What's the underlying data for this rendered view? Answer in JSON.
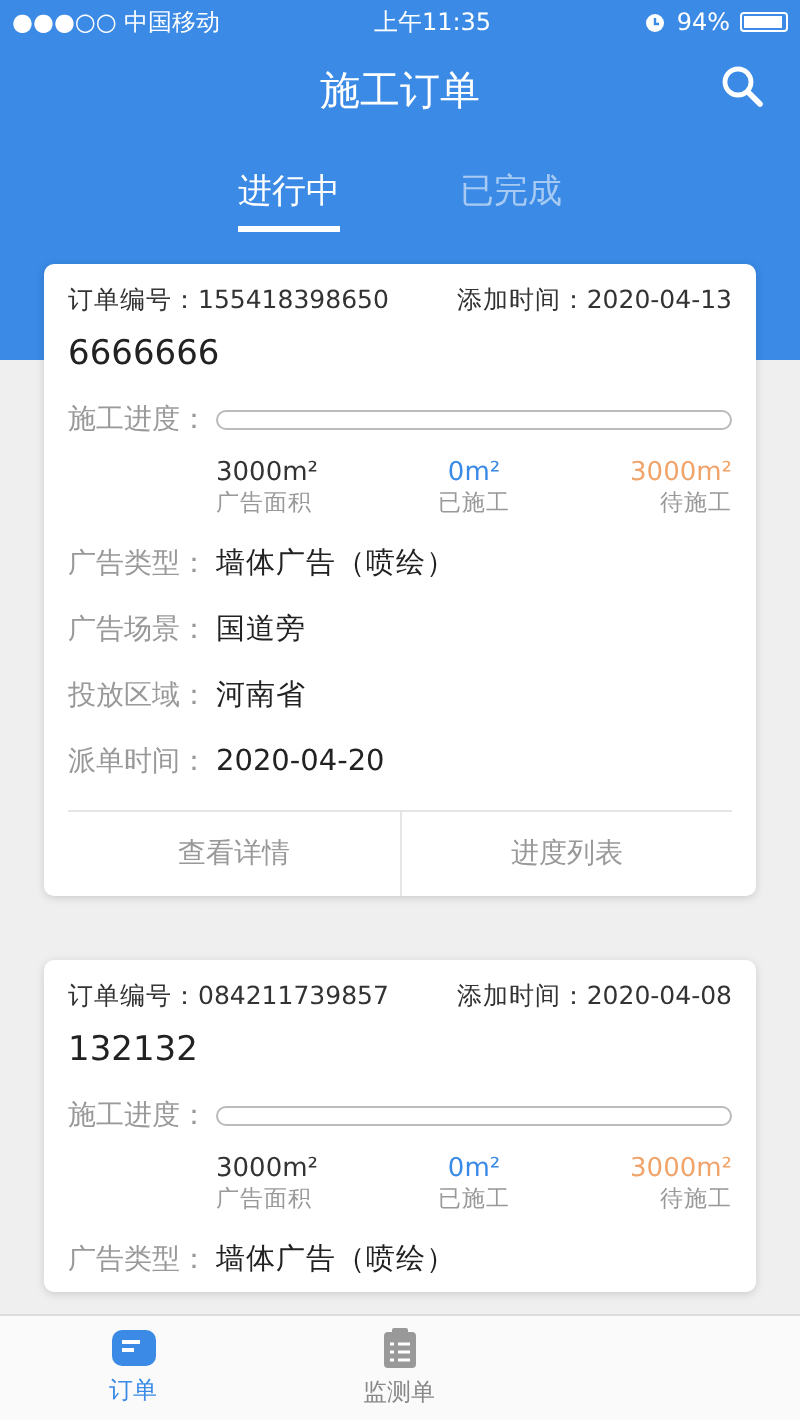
{
  "status_bar": {
    "carrier": "●●●○○ 中国移动",
    "time": "上午11:35",
    "battery": "94%"
  },
  "header": {
    "title": "施工订单"
  },
  "tabs": [
    {
      "label": "进行中",
      "selected": true
    },
    {
      "label": "已完成",
      "selected": false
    }
  ],
  "orders": [
    {
      "order_no_label": "订单编号：",
      "order_no": "155418398650",
      "added_label": "添加时间：",
      "added": "2020-04-13",
      "name": "6666666",
      "progress_label": "施工进度：",
      "level": 0,
      "stats": [
        {
          "value": "3000m²",
          "label": "广告面积",
          "kind": "total"
        },
        {
          "value": "0m²",
          "label": "已施工",
          "kind": "done"
        },
        {
          "value": "3000m²",
          "label": "待施工",
          "kind": "pending"
        }
      ],
      "fields": [
        {
          "label": "广告类型：",
          "value": "墙体广告（喷绘）"
        },
        {
          "label": "广告场景：",
          "value": "国道旁"
        },
        {
          "label": "投放区域：",
          "value": "河南省"
        },
        {
          "label": "派单时间：",
          "value": "2020-04-20"
        }
      ],
      "actions": [
        "查看详情",
        "进度列表"
      ]
    },
    {
      "order_no_label": "订单编号：",
      "order_no": "084211739857",
      "added_label": "添加时间：",
      "added": "2020-04-08",
      "name": "132132",
      "progress_label": "施工进度：",
      "level": 0,
      "stats": [
        {
          "value": "3000m²",
          "label": "广告面积",
          "kind": "total"
        },
        {
          "value": "0m²",
          "label": "已施工",
          "kind": "done"
        },
        {
          "value": "3000m²",
          "label": "待施工",
          "kind": "pending"
        }
      ],
      "fields": [
        {
          "label": "广告类型：",
          "value": "墙体广告（喷绘）"
        }
      ]
    }
  ],
  "tab_bar": [
    {
      "label": "订单",
      "selected": true,
      "kind": "orders"
    },
    {
      "label": "监测单",
      "selected": false,
      "kind": "monitor"
    }
  ]
}
